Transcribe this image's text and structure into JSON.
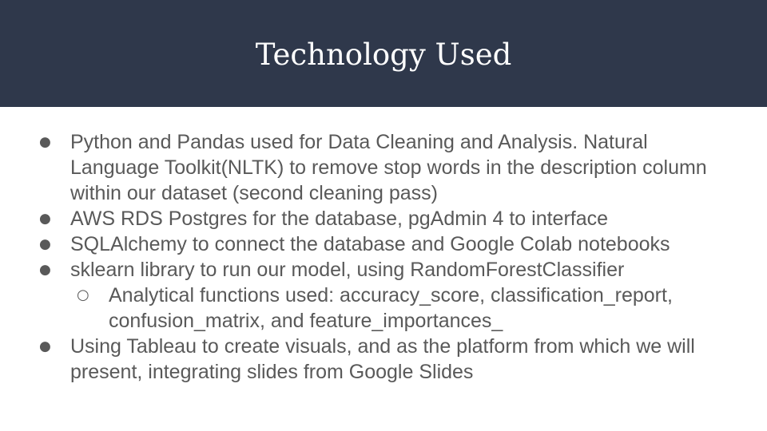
{
  "slide": {
    "title": "Technology Used",
    "header_color": "#2f384b",
    "text_color": "#595959",
    "bullets": [
      {
        "level": 1,
        "marker": "●",
        "text": "Python and Pandas used for Data Cleaning and Analysis. Natural Language Toolkit(NLTK) to remove stop words in the description column within our dataset (second cleaning pass)"
      },
      {
        "level": 1,
        "marker": "●",
        "text": "AWS RDS Postgres for the database, pgAdmin 4 to interface"
      },
      {
        "level": 1,
        "marker": "●",
        "text": "SQLAlchemy to connect the database and Google Colab notebooks"
      },
      {
        "level": 1,
        "marker": "●",
        "text": "sklearn library to run our model, using RandomForestClassifier"
      },
      {
        "level": 2,
        "marker": "○",
        "text": "Analytical functions used: accuracy_score, classification_report, confusion_matrix, and feature_importances_"
      },
      {
        "level": 1,
        "marker": "●",
        "text": "Using Tableau to create visuals, and as the platform from which we will present, integrating slides from Google Slides"
      }
    ]
  }
}
